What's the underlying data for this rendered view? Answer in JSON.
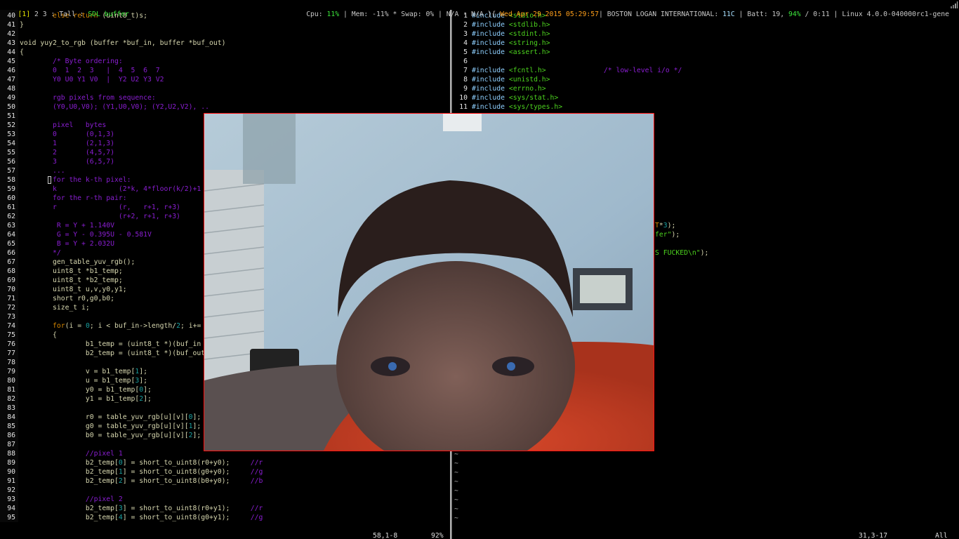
{
  "topbar": {
    "workspace_current": "[1]",
    "workspaces_other": " 2 3 : Tall : ",
    "window_title": "SDL buffer",
    "cpu_label": "Cpu: ",
    "cpu_value": "11%",
    "mem_swap": " | Mem: -11% * Swap: 0% | N/A - N/A }{ ",
    "datetime": "Wed Apr 29 2015 05:29:57",
    "weather_label": "| BOSTON LOGAN INTERNATIONAL: ",
    "temperature": "11C",
    "batt_label": " | Batt: 19, ",
    "batt_percent": "94%",
    "batt_rest": " / 0:11 | Linux 4.0.0-040000rc1-gene",
    "signal_icon": "wifi-signal-icon"
  },
  "left_editor": {
    "lines": [
      {
        "n": "40",
        "s": [
          [
            "        ",
            "n"
          ],
          [
            "else",
            "k"
          ],
          [
            " ",
            "n"
          ],
          [
            "return",
            "k"
          ],
          [
            " (uint8_t)s;",
            "n"
          ]
        ]
      },
      {
        "n": "41",
        "s": [
          [
            "}",
            "n"
          ]
        ]
      },
      {
        "n": "42",
        "s": []
      },
      {
        "n": "43",
        "s": [
          [
            "void yuy2_to_rgb (buffer *buf_in, buffer *buf_out)",
            "n"
          ]
        ]
      },
      {
        "n": "44",
        "s": [
          [
            "{",
            "n"
          ]
        ]
      },
      {
        "n": "45",
        "s": [
          [
            "        /* Byte ordering:",
            "c"
          ]
        ]
      },
      {
        "n": "46",
        "s": [
          [
            "        0  1  2  3   |  4  5  6  7",
            "c"
          ]
        ]
      },
      {
        "n": "47",
        "s": [
          [
            "        Y0 U0 Y1 V0  |  Y2 U2 Y3 V2",
            "c"
          ]
        ]
      },
      {
        "n": "48",
        "s": []
      },
      {
        "n": "49",
        "s": [
          [
            "        rgb pixels from sequence:",
            "c"
          ]
        ]
      },
      {
        "n": "50",
        "s": [
          [
            "        (Y0,U0,V0); (Y1,U0,V0); (Y2,U2,V2), ..",
            "c"
          ]
        ]
      },
      {
        "n": "51",
        "s": []
      },
      {
        "n": "52",
        "s": [
          [
            "        pixel   bytes",
            "c"
          ]
        ]
      },
      {
        "n": "53",
        "s": [
          [
            "        0       (0,1,3)",
            "c"
          ]
        ]
      },
      {
        "n": "54",
        "s": [
          [
            "        1       (2,1,3)",
            "c"
          ]
        ]
      },
      {
        "n": "55",
        "s": [
          [
            "        2       (4,5,7)",
            "c"
          ]
        ]
      },
      {
        "n": "56",
        "s": [
          [
            "        3       (6,5,7)",
            "c"
          ]
        ]
      },
      {
        "n": "57",
        "s": [
          [
            "        ...",
            "c"
          ]
        ]
      },
      {
        "n": "58",
        "s": [
          [
            "        for the k-th pixel:",
            "c"
          ]
        ],
        "cursor": true
      },
      {
        "n": "59",
        "s": [
          [
            "        k               (2*k, 4*floor(k/2)+1",
            "c"
          ]
        ]
      },
      {
        "n": "60",
        "s": [
          [
            "        for the r-th pair:",
            "c"
          ]
        ]
      },
      {
        "n": "61",
        "s": [
          [
            "        r               (r,   r+1, r+3)",
            "c"
          ]
        ]
      },
      {
        "n": "62",
        "s": [
          [
            "                        (r+2, r+1, r+3)",
            "c"
          ]
        ]
      },
      {
        "n": "63",
        "s": [
          [
            "         R = Y + 1.140V",
            "c"
          ]
        ]
      },
      {
        "n": "64",
        "s": [
          [
            "         G = Y - 0.395U - 0.581V",
            "c"
          ]
        ]
      },
      {
        "n": "65",
        "s": [
          [
            "         B = Y + 2.032U",
            "c"
          ]
        ]
      },
      {
        "n": "66",
        "s": [
          [
            "        */",
            "c"
          ]
        ]
      },
      {
        "n": "67",
        "s": [
          [
            "        gen_table_yuv_rgb();",
            "n"
          ]
        ]
      },
      {
        "n": "68",
        "s": [
          [
            "        uint8_t *b1_temp;",
            "n"
          ]
        ]
      },
      {
        "n": "69",
        "s": [
          [
            "        uint8_t *b2_temp;",
            "n"
          ]
        ]
      },
      {
        "n": "70",
        "s": [
          [
            "        uint8_t u,v,y0,y1;",
            "n"
          ]
        ]
      },
      {
        "n": "71",
        "s": [
          [
            "        short r0,g0,b0;",
            "n"
          ]
        ]
      },
      {
        "n": "72",
        "s": [
          [
            "        size_t i;",
            "n"
          ]
        ]
      },
      {
        "n": "73",
        "s": []
      },
      {
        "n": "74",
        "s": [
          [
            "        ",
            "n"
          ],
          [
            "for",
            "k"
          ],
          [
            "(i = ",
            "n"
          ],
          [
            "0",
            "d"
          ],
          [
            "; i < buf_in->length/",
            "n"
          ],
          [
            "2",
            "d"
          ],
          [
            "; i+=",
            "n"
          ]
        ]
      },
      {
        "n": "75",
        "s": [
          [
            "        {",
            "n"
          ]
        ]
      },
      {
        "n": "76",
        "s": [
          [
            "                b1_temp = (uint8_t *)(buf_in",
            "n"
          ]
        ]
      },
      {
        "n": "77",
        "s": [
          [
            "                b2_temp = (uint8_t *)(buf_out",
            "n"
          ]
        ]
      },
      {
        "n": "78",
        "s": []
      },
      {
        "n": "79",
        "s": [
          [
            "                v = b1_temp[",
            "n"
          ],
          [
            "1",
            "d"
          ],
          [
            "];",
            "n"
          ]
        ]
      },
      {
        "n": "80",
        "s": [
          [
            "                u = b1_temp[",
            "n"
          ],
          [
            "3",
            "d"
          ],
          [
            "];",
            "n"
          ]
        ]
      },
      {
        "n": "81",
        "s": [
          [
            "                y0 = b1_temp[",
            "n"
          ],
          [
            "0",
            "d"
          ],
          [
            "];",
            "n"
          ]
        ]
      },
      {
        "n": "82",
        "s": [
          [
            "                y1 = b1_temp[",
            "n"
          ],
          [
            "2",
            "d"
          ],
          [
            "];",
            "n"
          ]
        ]
      },
      {
        "n": "83",
        "s": []
      },
      {
        "n": "84",
        "s": [
          [
            "                r0 = table_yuv_rgb[u][v][",
            "n"
          ],
          [
            "0",
            "d"
          ],
          [
            "];",
            "n"
          ]
        ]
      },
      {
        "n": "85",
        "s": [
          [
            "                g0 = table_yuv_rgb[u][v][",
            "n"
          ],
          [
            "1",
            "d"
          ],
          [
            "];",
            "n"
          ]
        ]
      },
      {
        "n": "86",
        "s": [
          [
            "                b0 = table_yuv_rgb[u][v][",
            "n"
          ],
          [
            "2",
            "d"
          ],
          [
            "];",
            "n"
          ]
        ]
      },
      {
        "n": "87",
        "s": []
      },
      {
        "n": "88",
        "s": [
          [
            "                //pixel 1",
            "c"
          ]
        ]
      },
      {
        "n": "89",
        "s": [
          [
            "                b2_temp[",
            "n"
          ],
          [
            "0",
            "d"
          ],
          [
            "] = short_to_uint8(r0+y0);     ",
            "n"
          ],
          [
            "//r",
            "c"
          ]
        ]
      },
      {
        "n": "90",
        "s": [
          [
            "                b2_temp[",
            "n"
          ],
          [
            "1",
            "d"
          ],
          [
            "] = short_to_uint8(g0+y0);     ",
            "n"
          ],
          [
            "//g",
            "c"
          ]
        ]
      },
      {
        "n": "91",
        "s": [
          [
            "                b2_temp[",
            "n"
          ],
          [
            "2",
            "d"
          ],
          [
            "] = short_to_uint8(b0+y0);     ",
            "n"
          ],
          [
            "//b",
            "c"
          ]
        ]
      },
      {
        "n": "92",
        "s": []
      },
      {
        "n": "93",
        "s": [
          [
            "                //pixel 2",
            "c"
          ]
        ]
      },
      {
        "n": "94",
        "s": [
          [
            "                b2_temp[",
            "n"
          ],
          [
            "3",
            "d"
          ],
          [
            "] = short_to_uint8(r0+y1);     ",
            "n"
          ],
          [
            "//r",
            "c"
          ]
        ]
      },
      {
        "n": "95",
        "s": [
          [
            "                b2_temp[",
            "n"
          ],
          [
            "4",
            "d"
          ],
          [
            "] = short_to_uint8(g0+y1);     ",
            "n"
          ],
          [
            "//g",
            "c"
          ]
        ]
      }
    ],
    "status_position": "58,1-8",
    "status_percent": "92%"
  },
  "right_editor": {
    "lines": [
      {
        "n": "1",
        "s": [
          [
            "#include",
            "p"
          ],
          [
            " ",
            "n"
          ],
          [
            "<stdio.h>",
            "s"
          ]
        ]
      },
      {
        "n": "2",
        "s": [
          [
            "#include",
            "p"
          ],
          [
            " ",
            "n"
          ],
          [
            "<stdlib.h>",
            "s"
          ]
        ]
      },
      {
        "n": "3",
        "s": [
          [
            "#include",
            "p"
          ],
          [
            " ",
            "n"
          ],
          [
            "<stdint.h>",
            "s"
          ]
        ]
      },
      {
        "n": "4",
        "s": [
          [
            "#include",
            "p"
          ],
          [
            " ",
            "n"
          ],
          [
            "<string.h>",
            "s"
          ]
        ]
      },
      {
        "n": "5",
        "s": [
          [
            "#include",
            "p"
          ],
          [
            " ",
            "n"
          ],
          [
            "<assert.h>",
            "s"
          ]
        ]
      },
      {
        "n": "6",
        "s": []
      },
      {
        "n": "7",
        "s": [
          [
            "#include",
            "p"
          ],
          [
            " ",
            "n"
          ],
          [
            "<fcntl.h>",
            "s"
          ],
          [
            "              ",
            "n"
          ],
          [
            "/* low-level i/o */",
            "c"
          ]
        ]
      },
      {
        "n": "8",
        "s": [
          [
            "#include",
            "p"
          ],
          [
            " ",
            "n"
          ],
          [
            "<unistd.h>",
            "s"
          ]
        ]
      },
      {
        "n": "9",
        "s": [
          [
            "#include",
            "p"
          ],
          [
            " ",
            "n"
          ],
          [
            "<errno.h>",
            "s"
          ]
        ]
      },
      {
        "n": "10",
        "s": [
          [
            "#include",
            "p"
          ],
          [
            " ",
            "n"
          ],
          [
            "<sys/stat.h>",
            "s"
          ]
        ]
      },
      {
        "n": "11",
        "s": [
          [
            "#include",
            "p"
          ],
          [
            " ",
            "n"
          ],
          [
            "<sys/types.h>",
            "s"
          ]
        ]
      }
    ],
    "fragments": [
      [
        [
          "T",
          "k"
        ],
        [
          "*",
          "n"
        ],
        [
          "3",
          "d"
        ],
        [
          ");",
          "n"
        ]
      ],
      [
        [
          "fer\"",
          "s"
        ],
        [
          ");",
          "n"
        ]
      ],
      [
        [
          "S FUCKED\\n\"",
          "s"
        ],
        [
          ");",
          "n"
        ]
      ]
    ],
    "tilde": "~",
    "tilde_count": 8,
    "status_position": "31,3-17",
    "status_percent": "All"
  },
  "webcam": {
    "window_title": "SDL buffer",
    "border_color": "#ff1010"
  },
  "colors": {
    "keyword": "#d78700",
    "comment": "#8a1ed2",
    "number": "#18a0a0",
    "string": "#4cd21e",
    "preproc": "#8fd0ff",
    "text": "#d7d7af"
  }
}
